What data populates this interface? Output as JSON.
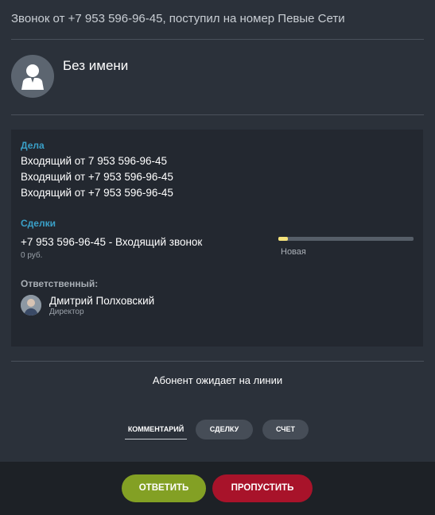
{
  "header": {
    "title": "Звонок от +7 953 596-96-45, поступил на номер Певые Сети"
  },
  "contact": {
    "name": "Без имени"
  },
  "card": {
    "tasks_label": "Дела",
    "tasks": [
      "Входящий от 7 953 596-96-45",
      "Входящий от +7 953 596-96-45",
      "Входящий от +7 953 596-96-45"
    ],
    "deals_label": "Сделки",
    "deal": {
      "title": "+7 953 596-96-45 - Входящий звонок",
      "amount": "0 руб.",
      "stage": "Новая",
      "progress_fraction": 0.07
    },
    "responsible_label": "Ответственный:",
    "responsible": {
      "name": "Дмитрий Полховский",
      "role": "Директор"
    }
  },
  "status": {
    "waiting": "Абонент ожидает на линии"
  },
  "tabs": [
    {
      "label": "КОММЕНТАРИЙ"
    },
    {
      "label": "СДЕЛКУ"
    },
    {
      "label": "СЧЕТ"
    }
  ],
  "actions": {
    "answer": "ОТВЕТИТЬ",
    "skip": "ПРОПУСТИТЬ"
  },
  "colors": {
    "accent_blue": "#3aa0c8",
    "answer_green": "#83a024",
    "skip_red": "#a8132a",
    "progress_yellow": "#f4e27a"
  }
}
